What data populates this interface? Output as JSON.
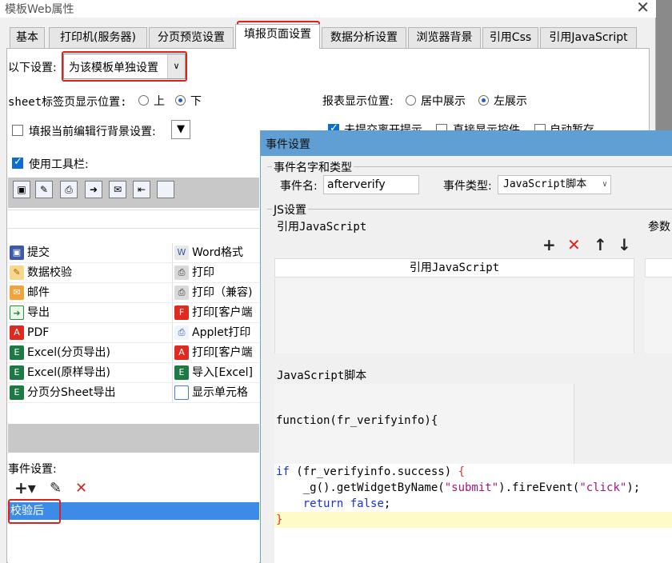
{
  "window": {
    "title": "模板Web属性",
    "close_glyph": "✕"
  },
  "tabs": [
    {
      "label": "基本"
    },
    {
      "label": "打印机(服务器)"
    },
    {
      "label": "分页预览设置"
    },
    {
      "label": "填报页面设置"
    },
    {
      "label": "数据分析设置"
    },
    {
      "label": "浏览器背景"
    },
    {
      "label": "引用Css"
    },
    {
      "label": "引用JavaScript"
    }
  ],
  "settings": {
    "scope_label": "以下设置:",
    "scope_value": "为该模板单独设置",
    "sheet_tab_label": "sheet标签页显示位置:",
    "sheet_tab_options": [
      "上",
      "下"
    ],
    "sheet_tab_selected": "下",
    "report_pos_label": "报表显示位置:",
    "report_pos_options": [
      "居中展示",
      "左展示"
    ],
    "report_pos_selected": "左展示",
    "bg_checkbox_label": "填报当前编辑行背景设置:",
    "use_toolbar_label": "使用工具栏:",
    "partial_options": [
      "未提交离开提示",
      "直接显示控件",
      "自动暂存"
    ]
  },
  "toolbar_icons": [
    "save-icon",
    "validate-icon",
    "print-icon",
    "export-icon",
    "mail-icon",
    "layout-icon",
    "blank-icon"
  ],
  "buttons": {
    "left": [
      {
        "label": "提交",
        "icon": "save-icon",
        "glyph": "▣"
      },
      {
        "label": "数据校验",
        "icon": "validate-icon",
        "glyph": "✎"
      },
      {
        "label": "邮件",
        "icon": "mail-icon",
        "glyph": "✉"
      },
      {
        "label": "导出",
        "icon": "export-icon",
        "glyph": "➜"
      },
      {
        "label": "PDF",
        "icon": "pdf-icon",
        "glyph": "A"
      },
      {
        "label": "Excel(分页导出)",
        "icon": "excel-icon",
        "glyph": "E"
      },
      {
        "label": "Excel(原样导出)",
        "icon": "excel-icon",
        "glyph": "E"
      },
      {
        "label": "分页分Sheet导出",
        "icon": "excel-icon",
        "glyph": "E"
      }
    ],
    "right": [
      {
        "label": "Word格式",
        "icon": "word-icon",
        "glyph": "W"
      },
      {
        "label": "打印",
        "icon": "print-icon",
        "glyph": "⎙"
      },
      {
        "label": "打印（兼容)",
        "icon": "print-icon",
        "glyph": "⎙"
      },
      {
        "label": "打印[客户端",
        "icon": "print-client-icon",
        "glyph": "F"
      },
      {
        "label": "Applet打印",
        "icon": "applet-icon",
        "glyph": "⎙"
      },
      {
        "label": "打印[客户端",
        "icon": "pdf-print-icon",
        "glyph": "A"
      },
      {
        "label": "导入[Excel]",
        "icon": "excel-icon",
        "glyph": "E"
      },
      {
        "label": "显示单元格",
        "icon": "cell-icon",
        "glyph": ""
      }
    ]
  },
  "events": {
    "label": "事件设置:",
    "add_glyph": "+▾",
    "edit_glyph": "✎",
    "delete_glyph": "✕",
    "items": [
      "校验后"
    ]
  },
  "dialog": {
    "title": "事件设置",
    "name_type_group": "事件名字和类型",
    "event_name_label": "事件名:",
    "event_name_value": "afterverify",
    "event_type_label": "事件类型:",
    "event_type_value": "JavaScript脚本",
    "js_group": "JS设置",
    "ref_js_label": "引用JavaScript",
    "params_label": "参数",
    "ref_js_header": "引用JavaScript",
    "js_toolbar": {
      "add": "+",
      "delete": "✕",
      "up": "↑",
      "down": "↓"
    },
    "script_label": "JavaScript脚本",
    "function_header": "function(fr_verifyinfo){",
    "code": {
      "line1_kw": "if",
      "line1_rest": " (fr_verifyinfo.success) ",
      "line1_brace": "{",
      "line2_pre": "    _g().getWidgetByName(",
      "line2_str1": "\"submit\"",
      "line2_mid": ").fireEvent(",
      "line2_str2": "\"click\"",
      "line2_post": ");",
      "line3_kw": "    return",
      "line3_val": " false",
      "line3_post": ";",
      "line4": "}"
    }
  },
  "colors": {
    "highlight_red": "#e0211b",
    "selection_blue": "#3d8be8",
    "dialog_title": "#5f9fd4"
  }
}
